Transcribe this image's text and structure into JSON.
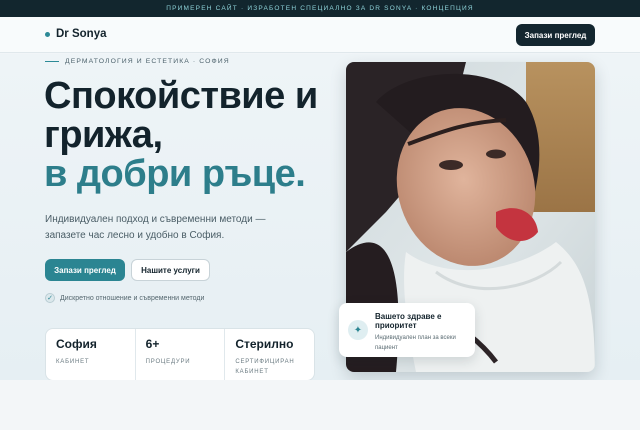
{
  "topbar": {
    "text": "Примерен сайт · изработен специално за Dr Sonya · концепция"
  },
  "nav": {
    "brand": "Dr Sonya",
    "cta": "Запази преглед"
  },
  "hero": {
    "eyebrow": "Дерматология и естетика · София",
    "headline_line1": "Спокойствие и",
    "headline_line2": "грижа,",
    "headline_accent": "в добри ръце.",
    "lead": "Индивидуален подход и съвременни методи — запазете час лесно и удобно в София.",
    "primary_button": "Запази преглед",
    "secondary_button": "Нашите услуги",
    "check_text": "Дискретно отношение и съвременни методи"
  },
  "stats": [
    {
      "value": "София",
      "label": "Кабинет"
    },
    {
      "value": "6+",
      "label": "Процедури"
    },
    {
      "value": "Стерилно",
      "label": "Сертифициран кабинет"
    }
  ],
  "card": {
    "title": "Вашето здраве е приоритет",
    "subtitle": "Индивидуален план за всеки пациент"
  },
  "colors": {
    "accent": "#2d8a97",
    "dark": "#13262f",
    "topbar": "#12262e"
  }
}
